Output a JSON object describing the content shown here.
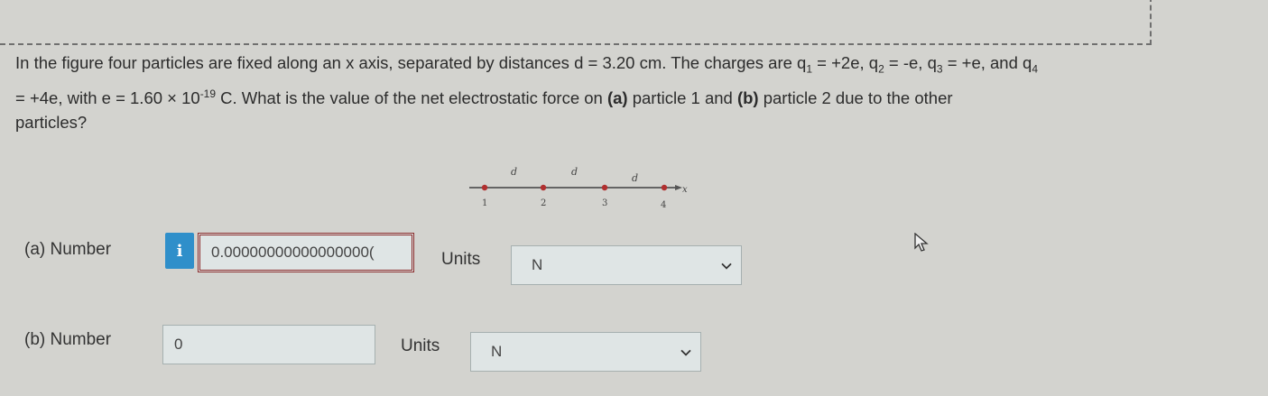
{
  "question": {
    "line1_a": "In the figure four particles are fixed along an x axis, separated by distances d = 3.20 cm. The charges are q",
    "line1_b": "1",
    "line1_c": " = +2e, q",
    "line1_d": "2",
    "line1_e": " = -e, q",
    "line1_f": "3",
    "line1_g": " = +e, and q",
    "line1_h": "4",
    "line2_a": "= +4e, with e = 1.60 × 10",
    "line2_sup": "-19",
    "line2_b": " C. What is the value of the net electrostatic force on ",
    "part_a_tag": "(a)",
    "line2_c": " particle 1 and ",
    "part_b_tag": "(b)",
    "line2_d": " particle 2 due to the other",
    "line3": "particles?"
  },
  "figure": {
    "distance_label": "d",
    "axis_label": "x",
    "particles": [
      "1",
      "2",
      "3",
      "4"
    ]
  },
  "part_a": {
    "label": "(a)   Number",
    "info_icon": "i",
    "value": "0.00000000000000000(",
    "units_label": "Units",
    "unit_value": "N"
  },
  "part_b": {
    "label": "(b)   Number",
    "value": "0",
    "units_label": "Units",
    "unit_value": "N"
  },
  "colors": {
    "background": "#d3d3cf",
    "info_button": "#2f8fca",
    "error_border": "#8a2b2b",
    "particle": "#b03030"
  }
}
